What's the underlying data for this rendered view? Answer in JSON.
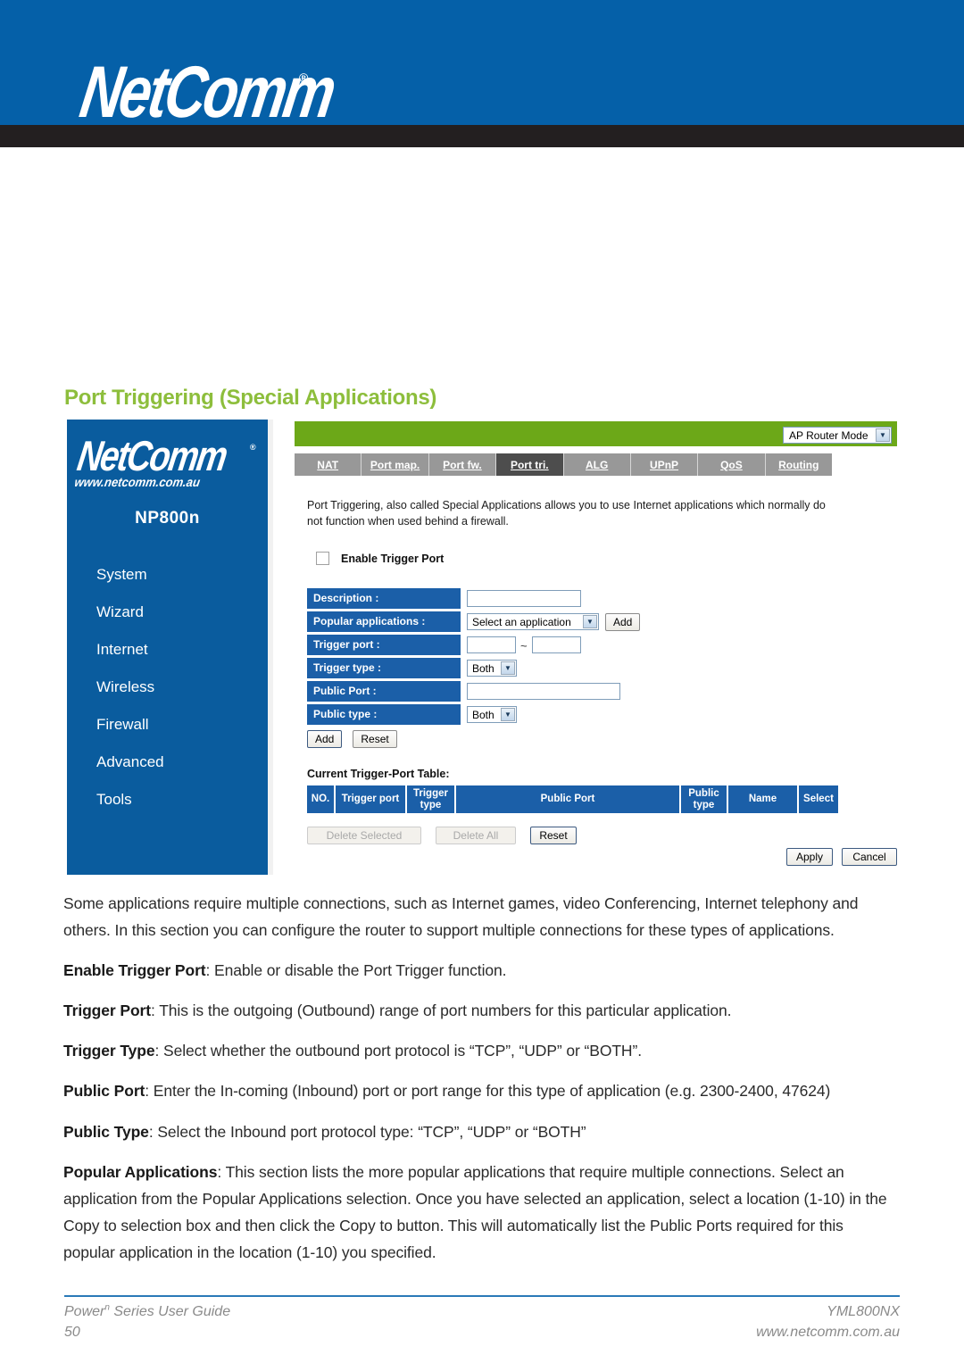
{
  "header": {
    "brand": "NetComm",
    "registered_mark": "®",
    "url": "www.netcomm.com.au",
    "bg_color": "#0560A8",
    "strip_color": "#231f20"
  },
  "page_title": "Port Triggering (Special Applications)",
  "title_color": "#8DBE3C",
  "router_ui": {
    "sidebar": {
      "logo": "NetComm",
      "registered_mark": "®",
      "url": "www.netcomm.com.au",
      "model": "NP800n",
      "bg_color": "#0A5C9E",
      "items": [
        {
          "label": "System"
        },
        {
          "label": "Wizard"
        },
        {
          "label": "Internet"
        },
        {
          "label": "Wireless"
        },
        {
          "label": "Firewall"
        },
        {
          "label": "Advanced"
        },
        {
          "label": "Tools"
        }
      ]
    },
    "green_bar_color": "#6CA818",
    "mode_select": {
      "value": "AP Router Mode",
      "caret": "▼"
    },
    "tabs": [
      {
        "label": "NAT",
        "active": false
      },
      {
        "label": "Port map.",
        "active": false
      },
      {
        "label": "Port fw.",
        "active": false
      },
      {
        "label": "Port tri.",
        "active": true
      },
      {
        "label": "ALG",
        "active": false
      },
      {
        "label": "UPnP",
        "active": false
      },
      {
        "label": "QoS",
        "active": false
      },
      {
        "label": "Routing",
        "active": false
      }
    ],
    "description": "Port Triggering, also called Special Applications allows you to use Internet applications which normally do not function when used behind a firewall.",
    "enable_checkbox_label": "Enable Trigger Port",
    "form": {
      "description_label": "Description :",
      "description_value": "",
      "popular_label": "Popular applications :",
      "popular_value": "Select an application",
      "popular_add_button": "Add",
      "trigger_port_label": "Trigger port :",
      "trigger_port_from": "",
      "trigger_port_separator": "~",
      "trigger_port_to": "",
      "trigger_type_label": "Trigger type :",
      "trigger_type_value": "Both",
      "public_port_label": "Public Port :",
      "public_port_value": "",
      "public_type_label": "Public type :",
      "public_type_value": "Both",
      "caret": "▼"
    },
    "actions": {
      "add": "Add",
      "reset": "Reset"
    },
    "table_title": "Current Trigger-Port Table:",
    "table_headers": [
      "NO.",
      "Trigger port",
      "Trigger type",
      "Public Port",
      "Public type",
      "Name",
      "Select"
    ],
    "table_header_color": "#1B5FA8",
    "bottom_actions": {
      "delete_selected": "Delete Selected",
      "delete_all": "Delete All",
      "reset": "Reset"
    },
    "apply_actions": {
      "apply": "Apply",
      "cancel": "Cancel"
    }
  },
  "body": {
    "p1": "Some applications require multiple connections, such as Internet games, video Conferencing, Internet telephony and others. In this section you can configure the router to support multiple connections for these types of applications.",
    "p2_term": "Enable Trigger Port",
    "p2_text": ": Enable or disable the Port Trigger function.",
    "p3_term": "Trigger Port",
    "p3_text": ": This is the outgoing (Outbound) range of port numbers for this particular application.",
    "p4_term": "Trigger Type",
    "p4_text": ": Select whether the outbound port protocol is “TCP”, “UDP” or “BOTH”.",
    "p5_term": "Public Port",
    "p5_text": ": Enter the In-coming (Inbound) port or port range for this type of application (e.g. 2300-2400, 47624)",
    "p6_term": "Public Type",
    "p6_text": ": Select the Inbound port protocol type: “TCP”, “UDP” or “BOTH”",
    "p7_term": "Popular Applications",
    "p7_text": ": This section lists the more popular applications that require multiple connections. Select an application from the Popular Applications selection. Once you have selected an application, select a location (1-10) in the Copy to selection box and then click the Copy to button. This will automatically list the Public Ports required for this popular application in the location (1-10) you specified."
  },
  "footer": {
    "guide_prefix": "Power",
    "guide_sup": "n",
    "guide_suffix": " Series User Guide",
    "page_number": "50",
    "doc_code": "YML800NX",
    "url": "www.netcomm.com.au",
    "rule_color": "#2a7ab8"
  }
}
